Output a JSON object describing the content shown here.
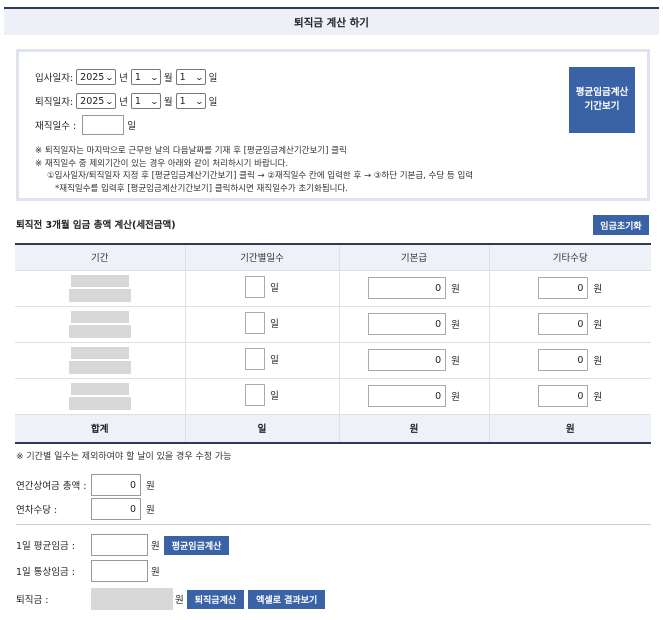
{
  "page_title": "퇴직금 계산 하기",
  "dates": {
    "join_label": "입사일자:",
    "leave_label": "퇴직일자:",
    "year_unit": "년",
    "month_unit": "월",
    "day_unit": "일",
    "join_year": "2025",
    "join_month": "1",
    "join_day": "1",
    "leave_year": "2025",
    "leave_month": "1",
    "leave_day": "1",
    "workdays_label": "재직일수 :",
    "workdays_value": "",
    "workdays_unit": "일"
  },
  "avg_period_button": {
    "line1": "평균임금계산",
    "line2": "기간보기"
  },
  "notes": [
    "※ 퇴직일자는 마지막으로 근무한 날의 다음날짜를 기재 후 [평균임금계산기간보기] 클릭",
    "※ 재직일수 중 제외기간이 있는 경우 아래와 같이 처리하시기 바랍니다.",
    "①입사일자/퇴직일자 지정 후 [평균임금계산기간보기] 클릭 → ②재직일수 칸에 입력한 후 → ③하단 기본급, 수당 등 입력",
    "*재직일수를 입력후 [평균임금계산기간보기] 클릭하시면 재직일수가 초기화됩니다."
  ],
  "wage_section": {
    "title": "퇴직전 3개월 임금 총액 계산(세전금액)",
    "reset_button": "임금초기화",
    "headers": [
      "기간",
      "기간별일수",
      "기본급",
      "기타수당"
    ],
    "rows": [
      {
        "days": "",
        "base": "0",
        "other": "0"
      },
      {
        "days": "",
        "base": "0",
        "other": "0"
      },
      {
        "days": "",
        "base": "0",
        "other": "0"
      },
      {
        "days": "",
        "base": "0",
        "other": "0"
      }
    ],
    "day_unit": "일",
    "won_unit": "원",
    "total_label": "합계",
    "total_days_unit": "일",
    "total_base_unit": "원",
    "total_other_unit": "원"
  },
  "footnote": "※ 기간별 일수는 제외하여야 할 날이 있을 경우 수정 가능",
  "bonus": {
    "label": "연간상여금 총액 :",
    "value": "0",
    "unit": "원"
  },
  "annual_leave": {
    "label": "연차수당 :",
    "value": "0",
    "unit": "원"
  },
  "daily_avg": {
    "label": "1일 평균임금 :",
    "value": "",
    "unit": "원",
    "button": "평균임금계산"
  },
  "daily_ordinary": {
    "label": "1일 통상임금 :",
    "value": "",
    "unit": "원"
  },
  "severance": {
    "label": "퇴직금 :",
    "unit": "원",
    "calc_button": "퇴직금계산",
    "excel_button": "엑셀로 결과보기"
  },
  "colors": {
    "accent": "#3a62a7",
    "header_bg": "#eef1f8",
    "border_dark": "#2e3b58"
  }
}
